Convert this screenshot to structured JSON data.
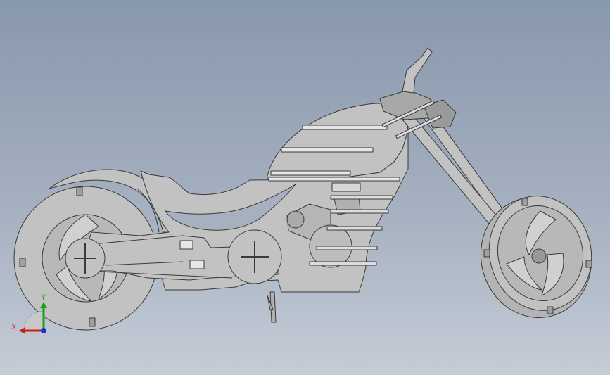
{
  "viewport": {
    "model": "motorcycle-assembly",
    "colors": {
      "background_top": "#8898ad",
      "background_bottom": "#c4ccd6",
      "part_fill": "#c2c2c2",
      "part_stroke": "#3a3a3a",
      "dark_part": "#6f6f6f"
    }
  },
  "triad": {
    "x_label": "X",
    "y_label": "Y",
    "colors": {
      "x": "#d01818",
      "y": "#18a018",
      "z": "#1830d0"
    }
  }
}
